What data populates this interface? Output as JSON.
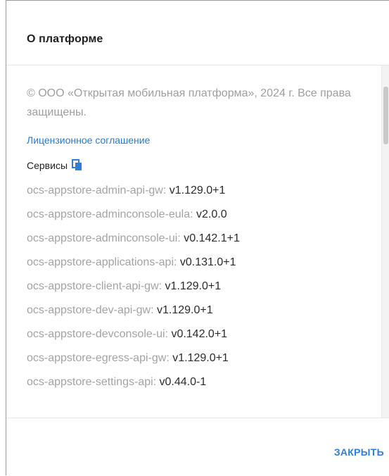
{
  "dialog": {
    "title": "О платформе",
    "copyright": "© ООО «Открытая мобильная платформа», 2024 г. Все права защищены.",
    "license_link": "Лицензионное соглашение",
    "services_label": "Сервисы",
    "close_label": "ЗАКРЫТЬ",
    "copy_icon": "copy-icon",
    "accent_color": "#2f7fd8",
    "services": [
      {
        "name": "ocs-appstore-admin-api-gw",
        "version": "v1.129.0+1"
      },
      {
        "name": "ocs-appstore-adminconsole-eula",
        "version": "v2.0.0"
      },
      {
        "name": "ocs-appstore-adminconsole-ui",
        "version": "v0.142.1+1"
      },
      {
        "name": "ocs-appstore-applications-api",
        "version": "v0.131.0+1"
      },
      {
        "name": "ocs-appstore-client-api-gw",
        "version": "v1.129.0+1"
      },
      {
        "name": "ocs-appstore-dev-api-gw",
        "version": "v1.129.0+1"
      },
      {
        "name": "ocs-appstore-devconsole-ui",
        "version": "v0.142.0+1"
      },
      {
        "name": "ocs-appstore-egress-api-gw",
        "version": "v1.129.0+1"
      },
      {
        "name": "ocs-appstore-settings-api",
        "version": "v0.44.0-1"
      }
    ]
  }
}
